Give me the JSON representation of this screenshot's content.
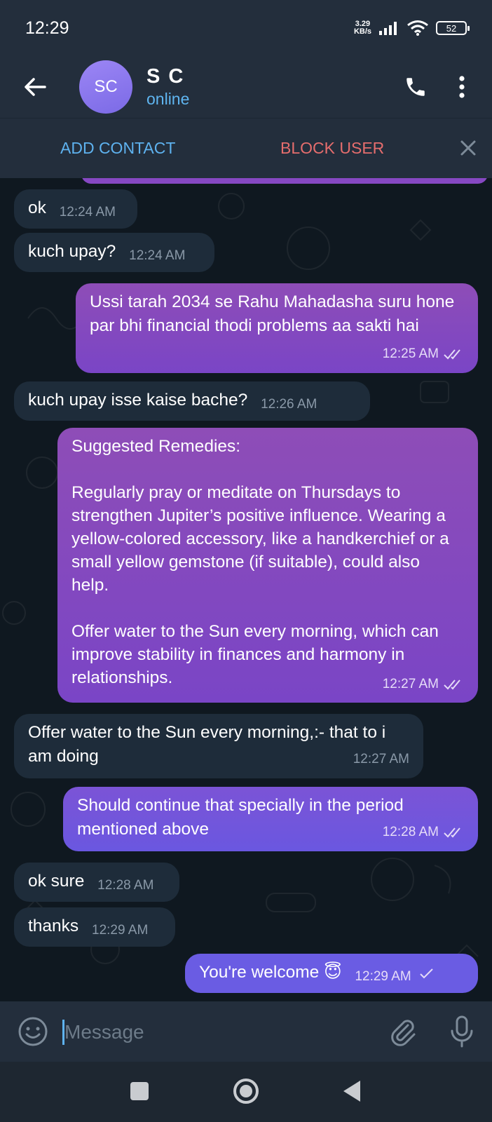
{
  "status_bar": {
    "time": "12:29",
    "net_speed_value": "3.29",
    "net_speed_unit": "KB/s",
    "battery": "52"
  },
  "header": {
    "avatar_initials": "SC",
    "name": "S C",
    "status": "online"
  },
  "action_bar": {
    "add_contact": "ADD CONTACT",
    "block_user": "BLOCK USER"
  },
  "messages": [
    {
      "direction": "in",
      "text": "ok",
      "time": "12:24 AM"
    },
    {
      "direction": "in",
      "text": "kuch upay?",
      "time": "12:24 AM"
    },
    {
      "direction": "out",
      "text": "Ussi tarah 2034 se Rahu Mahadasha suru hone par bhi financial thodi problems aa sakti hai",
      "time": "12:25 AM",
      "status": "read"
    },
    {
      "direction": "in",
      "text": "kuch upay isse kaise bache?",
      "time": "12:26 AM"
    },
    {
      "direction": "out",
      "text": "Suggested Remedies:\n\nRegularly pray or meditate on Thursdays to strengthen Jupiter’s positive influence. Wearing a yellow-colored accessory, like a handkerchief or a small yellow gemstone (if suitable), could also help.\n\nOffer water to the Sun every morning, which can improve stability in finances and harmony in relationships.",
      "time": "12:27 AM",
      "status": "read"
    },
    {
      "direction": "in",
      "text": "Offer water to the Sun every morning,:- that to i am doing",
      "time": "12:27 AM"
    },
    {
      "direction": "out",
      "text": "Should continue that specially in the period mentioned above",
      "time": "12:28 AM",
      "status": "read"
    },
    {
      "direction": "in",
      "text": "ok sure",
      "time": "12:28 AM"
    },
    {
      "direction": "in",
      "text": "thanks",
      "time": "12:29 AM"
    },
    {
      "direction": "out",
      "text": "You're welcome 😇",
      "time": "12:29 AM",
      "status": "sent"
    }
  ],
  "input": {
    "placeholder": "Message"
  },
  "icons": {
    "back": "back-arrow-icon",
    "call": "phone-icon",
    "menu": "more-vertical-icon",
    "close": "close-icon",
    "emoji": "emoji-icon",
    "attach": "paperclip-icon",
    "mic": "microphone-icon"
  },
  "colors": {
    "accent": "#5eb2ef",
    "danger": "#e56d6d",
    "outgoing_bubble": "#7a45c6",
    "incoming_bubble": "#1e2c3a"
  }
}
